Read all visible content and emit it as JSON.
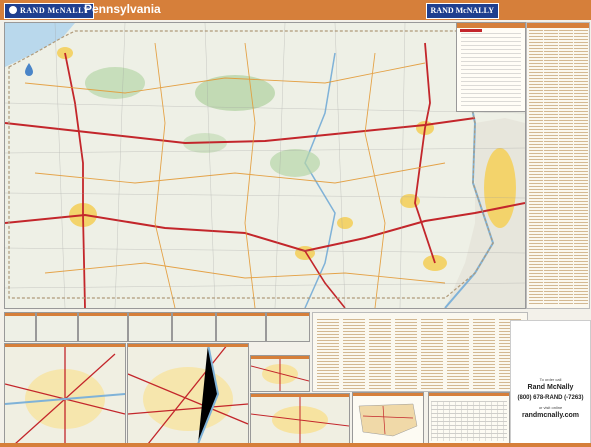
{
  "header": {
    "brand_left": "RAND McNALLY",
    "title": "Pennsylvania",
    "brand_right": "RAND McNALLY",
    "bar_color": "#d67f3a",
    "brand_color": "#1f3f8f"
  },
  "map": {
    "land_color": "#eef0e6",
    "water_color": "#b9d8ec",
    "forest_color": "#b7d5a8",
    "urban_color": "#f3d36b",
    "highway_color": "#c3262b",
    "secondary_road_color": "#e39a36"
  },
  "info": {
    "line1": "To order call",
    "line2": "Rand McNally",
    "line3": "(800) 678-RAND (-7263)",
    "line4": "or visit online",
    "line5": "randmcnally.com"
  },
  "icons": {
    "brand": "globe-icon",
    "water": "water-drop-icon"
  }
}
